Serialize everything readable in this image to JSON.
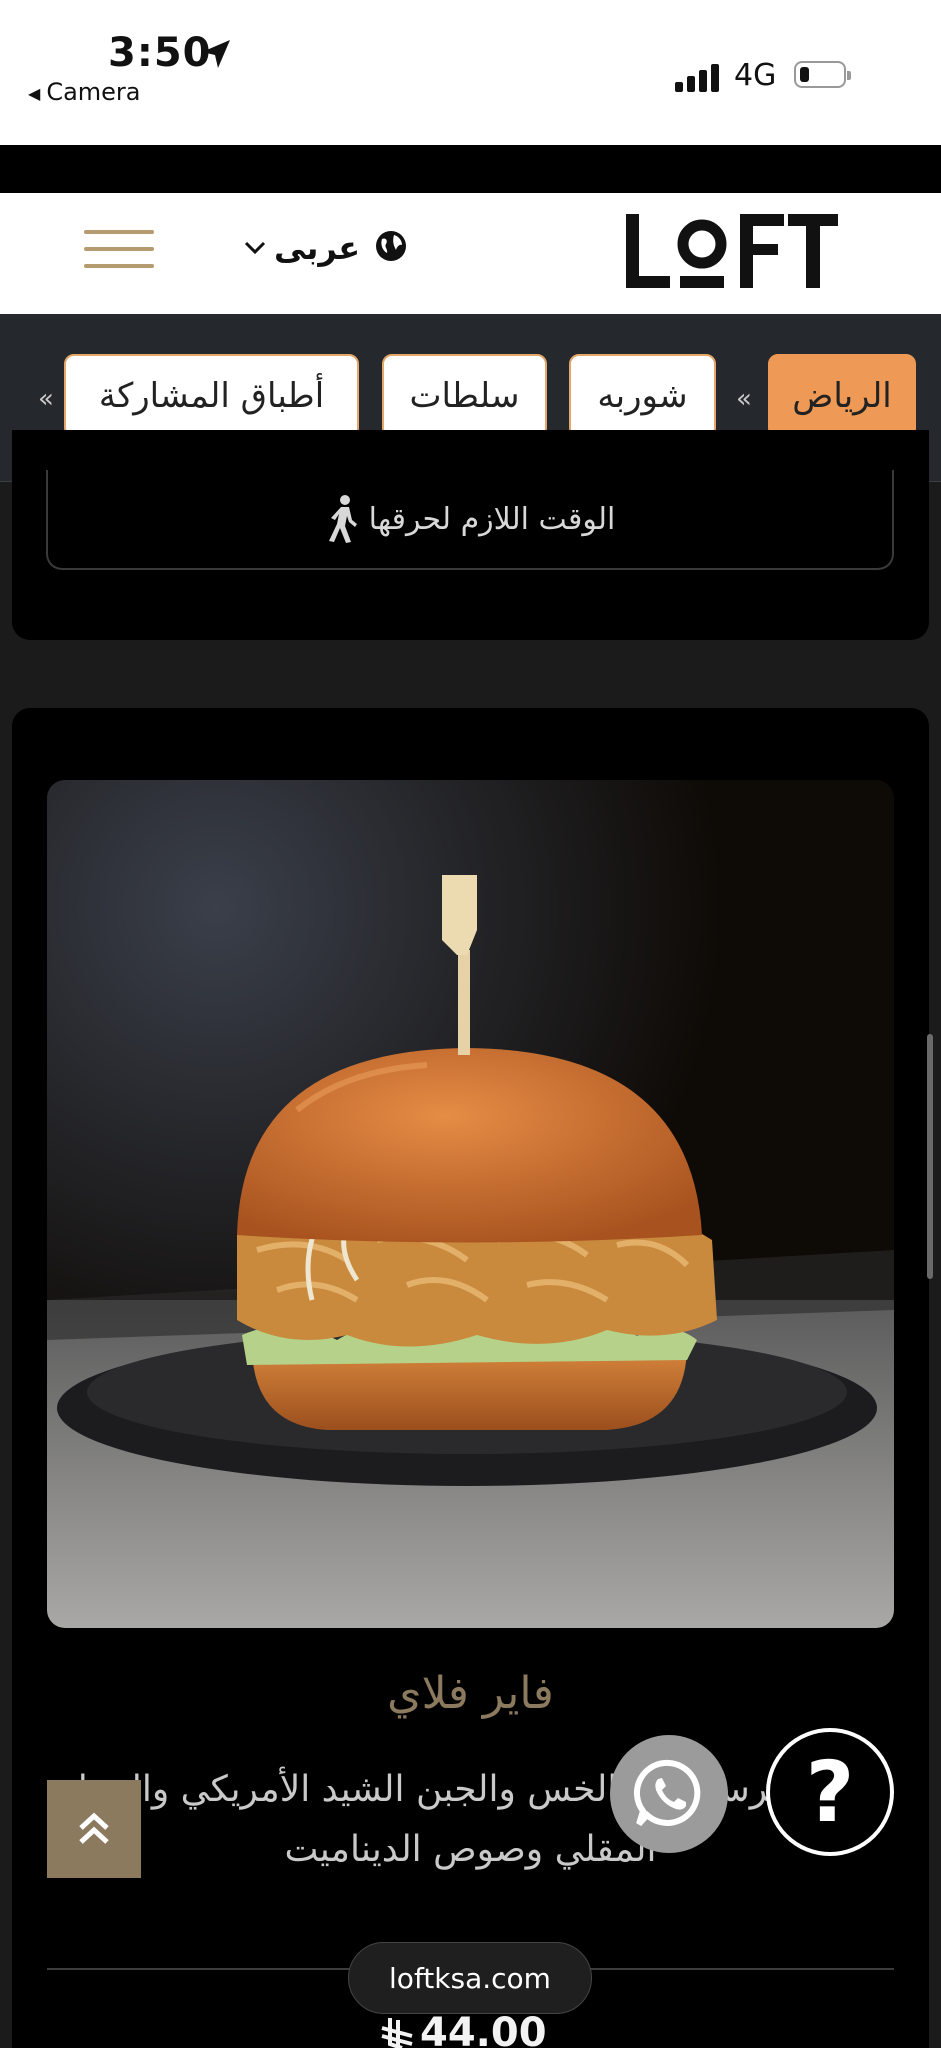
{
  "status_bar": {
    "time": "3:50",
    "back_label": "Camera",
    "network": "4G"
  },
  "header": {
    "language": "عربى",
    "logo": "LOFT",
    "icons": [
      "hamburger-menu-icon",
      "chevron-down-icon",
      "globe-icon"
    ]
  },
  "category_nav": {
    "items": [
      {
        "label": "الرياض",
        "active": true
      },
      {
        "label": "شوربه",
        "active": false
      },
      {
        "label": "سلطات",
        "active": false
      },
      {
        "label": "أطباق المشاركة",
        "active": false
      }
    ],
    "prev_arrows": "«",
    "next_arrows": "«"
  },
  "previous_item": {
    "burn_time_label": "الوقت اللازم لحرقها"
  },
  "menu_item": {
    "name": "فاير فلاي",
    "description": "حت الكرسبي مع الخس والجبن الشيد الأمريكي والبصل المقلي وصوص الديناميت",
    "price": "44.00",
    "currency_icon": "riyal-icon"
  },
  "floating": {
    "help_label": "?",
    "whatsapp_icon": "whatsapp-icon",
    "scroll_top_icon": "double-chevron-up-icon"
  },
  "browser": {
    "url": "loftksa.com"
  },
  "colors": {
    "accent_gold": "#8c7a5f",
    "active_pill": "#ee9a56",
    "pill_border": "#e3a86a",
    "nav_bg": "#25282d"
  }
}
